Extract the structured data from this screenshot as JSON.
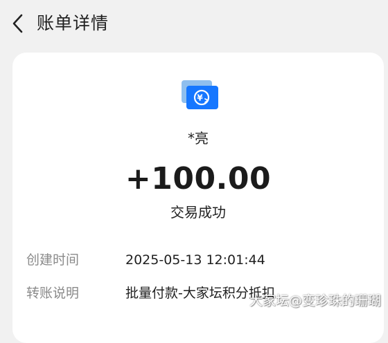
{
  "header": {
    "title": "账单详情",
    "back_icon": "chevron-left-icon"
  },
  "transaction": {
    "icon": "transfer-icon",
    "icon_colors": {
      "back_card": "#8fbfee",
      "front_card": "#1677ff",
      "glyph": "#ffffff"
    },
    "payer": "*亮",
    "amount": "+100.00",
    "status": "交易成功"
  },
  "details": [
    {
      "label": "创建时间",
      "value": "2025-05-13 12:01:44"
    },
    {
      "label": "转账说明",
      "value": "批量付款-大家坛积分抵扣"
    }
  ],
  "watermark": "大家坛@变珍珠的珊瑚"
}
